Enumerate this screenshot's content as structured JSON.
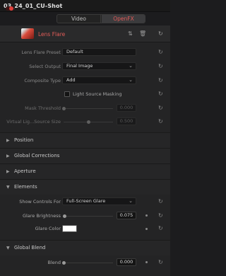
{
  "window": {
    "title": "03_24_01_CU-Shot"
  },
  "tabs": {
    "video": "Video",
    "openfx": "OpenFX"
  },
  "effect": {
    "name": "Lens Flare"
  },
  "controls": {
    "preset_label": "Lens Flare Preset",
    "preset_value": "Default",
    "select_output_label": "Select Output",
    "select_output_value": "Final Image",
    "composite_type_label": "Composite Type",
    "composite_type_value": "Add",
    "light_source_masking_label": "Light Source Masking",
    "mask_threshold_label": "Mask Threshold",
    "mask_threshold_value": "0.000",
    "virtual_light_label": "Virtual Lig...Source Size",
    "virtual_light_value": "0.500"
  },
  "sections": {
    "position": "Position",
    "global_corrections": "Global Corrections",
    "aperture": "Aperture",
    "elements": "Elements",
    "global_blend": "Global Blend"
  },
  "elements": {
    "show_controls_label": "Show Controls For",
    "show_controls_value": "Full-Screen Glare",
    "glare_brightness_label": "Glare Brightness",
    "glare_brightness_value": "0.075",
    "glare_color_label": "Glare Color"
  },
  "blend": {
    "blend_label": "Blend",
    "blend_value": "0.000"
  },
  "icons": {
    "reset": "reset-icon",
    "delete": "trash-icon",
    "reorder": "reorder-arrows-icon",
    "dropdown": "chevron-updown-icon",
    "keyframe": "keyframe-dot-icon"
  },
  "colors": {
    "accent": "#e05a57",
    "glare_color": "#ffffff"
  }
}
